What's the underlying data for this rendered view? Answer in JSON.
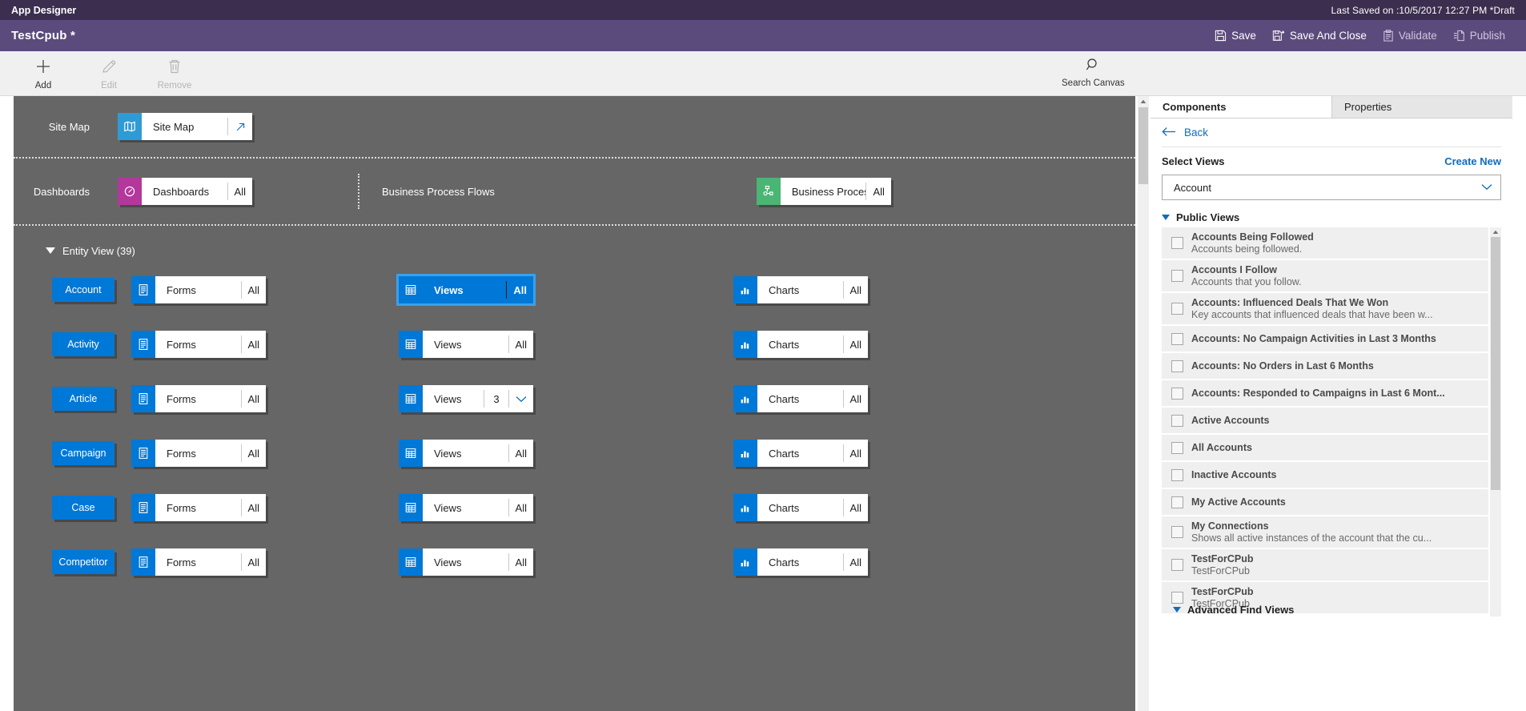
{
  "titlebar": {
    "app_title": "App Designer",
    "last_saved": "Last Saved on :10/5/2017 12:27 PM *Draft"
  },
  "commandbar": {
    "app_name": "TestCpub *",
    "actions": [
      {
        "label": "Save",
        "icon": "save-icon",
        "enabled": true
      },
      {
        "label": "Save And Close",
        "icon": "save-close-icon",
        "enabled": true
      },
      {
        "label": "Validate",
        "icon": "validate-icon",
        "enabled": false
      },
      {
        "label": "Publish",
        "icon": "publish-icon",
        "enabled": false
      }
    ]
  },
  "ribbon": {
    "add_label": "Add",
    "edit_label": "Edit",
    "remove_label": "Remove",
    "search_canvas_label": "Search Canvas"
  },
  "canvas": {
    "sitemap": {
      "row_label": "Site Map",
      "tile_label": "Site Map",
      "icon": "map-icon",
      "open_icon": "open-arrow-icon",
      "accent": "#2e9bd6"
    },
    "dashboards": {
      "row_label": "Dashboards",
      "tile_label": "Dashboards",
      "count": "All",
      "icon": "dashboard-icon",
      "accent": "#b4379c"
    },
    "bpf": {
      "row_label": "Business Process Flows",
      "tile_label": "Business Proces...",
      "count": "All",
      "icon": "process-flow-icon",
      "accent": "#4bb573"
    },
    "entity_section": {
      "title": "Entity View (39)",
      "col_forms_label": "Forms",
      "col_views_label": "Views",
      "col_charts_label": "Charts",
      "forms_icon": "form-icon",
      "views_icon": "grid-icon",
      "charts_icon": "bar-chart-icon",
      "rows": [
        {
          "entity": "Account",
          "forms": "All",
          "views": "All",
          "charts": "All",
          "views_selected": true,
          "views_chevron": false
        },
        {
          "entity": "Activity",
          "forms": "All",
          "views": "All",
          "charts": "All",
          "views_selected": false,
          "views_chevron": false
        },
        {
          "entity": "Article",
          "forms": "All",
          "views": "3",
          "charts": "All",
          "views_selected": false,
          "views_chevron": true
        },
        {
          "entity": "Campaign",
          "forms": "All",
          "views": "All",
          "charts": "All",
          "views_selected": false,
          "views_chevron": false
        },
        {
          "entity": "Case",
          "forms": "All",
          "views": "All",
          "charts": "All",
          "views_selected": false,
          "views_chevron": false
        },
        {
          "entity": "Competitor",
          "forms": "All",
          "views": "All",
          "charts": "All",
          "views_selected": false,
          "views_chevron": false
        }
      ]
    }
  },
  "right_panel": {
    "tabs": [
      {
        "label": "Components",
        "active": true
      },
      {
        "label": "Properties",
        "active": false
      }
    ],
    "back_label": "Back",
    "select_label": "Select Views",
    "create_new_label": "Create New",
    "entity_dropdown_value": "Account",
    "public_views_label": "Public Views",
    "advanced_find_label": "Advanced Find Views",
    "views": [
      {
        "name": "Accounts Being Followed",
        "desc": "Accounts being followed.",
        "checked": false
      },
      {
        "name": "Accounts I Follow",
        "desc": "Accounts that you follow.",
        "checked": false
      },
      {
        "name": "Accounts: Influenced Deals That We Won",
        "desc": "Key accounts that influenced deals that have been w...",
        "checked": false
      },
      {
        "name": "Accounts: No Campaign Activities in Last 3 Months",
        "desc": "",
        "checked": false
      },
      {
        "name": "Accounts: No Orders in Last 6 Months",
        "desc": "",
        "checked": false
      },
      {
        "name": "Accounts: Responded to Campaigns in Last 6 Mont...",
        "desc": "",
        "checked": false
      },
      {
        "name": "Active Accounts",
        "desc": "",
        "checked": false
      },
      {
        "name": "All Accounts",
        "desc": "",
        "checked": false
      },
      {
        "name": "Inactive Accounts",
        "desc": "",
        "checked": false
      },
      {
        "name": "My Active Accounts",
        "desc": "",
        "checked": false
      },
      {
        "name": "My Connections",
        "desc": "Shows all active instances of the account that the cu...",
        "checked": false
      },
      {
        "name": "TestForCPub",
        "desc": "TestForCPub",
        "checked": false
      },
      {
        "name": "TestForCPub",
        "desc": "TestForCPub",
        "checked": false
      }
    ]
  },
  "colors": {
    "title_purple": "#3b2e4f",
    "command_purple": "#5b4b7d",
    "canvas_gray": "#666666",
    "accent_blue": "#0078d7",
    "link_blue": "#0f6cbd"
  }
}
